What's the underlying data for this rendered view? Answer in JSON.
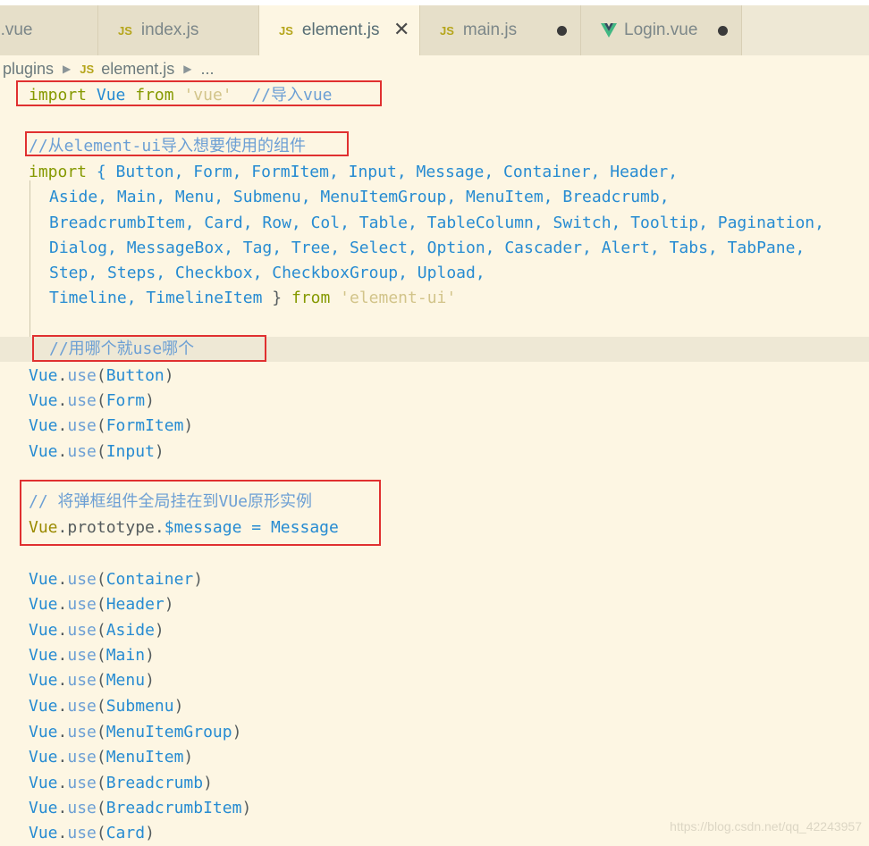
{
  "tabs": [
    {
      "label": "p.vue",
      "icon": "none",
      "modified": false
    },
    {
      "label": "index.js",
      "icon": "js-icon",
      "modified": false
    },
    {
      "label": "element.js",
      "icon": "js-icon",
      "modified": false,
      "active": true
    },
    {
      "label": "main.js",
      "icon": "js-icon",
      "modified": true
    },
    {
      "label": "Login.vue",
      "icon": "vue-icon",
      "modified": true
    }
  ],
  "tab_icon_text": "JS",
  "close_symbol": "✕",
  "breadcrumb": {
    "folder": "plugins",
    "file": "element.js",
    "more": "..."
  },
  "code": {
    "l1": {
      "import": "import",
      "name": "Vue",
      "from": "from",
      "str": "'vue'",
      "comment": "//导入vue"
    },
    "l2_comment": "//从element-ui导入想要使用的组件",
    "l3": {
      "import": "import",
      "rest": "{ Button, Form, FormItem, Input, Message, Container, Header,"
    },
    "l4": "Aside, Main, Menu, Submenu, MenuItemGroup, MenuItem, Breadcrumb,",
    "l5": "BreadcrumbItem, Card, Row, Col, Table, TableColumn, Switch, Tooltip, Pagination,",
    "l6": "Dialog, MessageBox, Tag, Tree, Select, Option, Cascader, Alert, Tabs, TabPane,",
    "l7": "Step, Steps, Checkbox, CheckboxGroup, Upload,",
    "l8": {
      "names": "Timeline, TimelineItem",
      "brace": "}",
      "from": "from",
      "str": "'element-ui'"
    },
    "l9_comment": "//用哪个就use哪个",
    "use_lines_a": [
      "Button",
      "Form",
      "FormItem",
      "Input"
    ],
    "l10_comment": "// 将弹框组件全局挂在到VUe原形实例",
    "l11": {
      "obj": "Vue",
      "mid": ".prototype.",
      "prop": "$message",
      "eq": "=",
      "val": "Message"
    },
    "use_lines_b": [
      "Container",
      "Header",
      "Aside",
      "Main",
      "Menu",
      "Submenu",
      "MenuItemGroup",
      "MenuItem",
      "Breadcrumb",
      "BreadcrumbItem",
      "Card"
    ],
    "vue": "Vue",
    "use": "use"
  },
  "watermark": "https://blog.csdn.net/qq_42243957",
  "colors": {
    "background": "#fdf6e3",
    "annotation": "#e03030",
    "keyword": "#859900",
    "identifier": "#268bd2"
  }
}
